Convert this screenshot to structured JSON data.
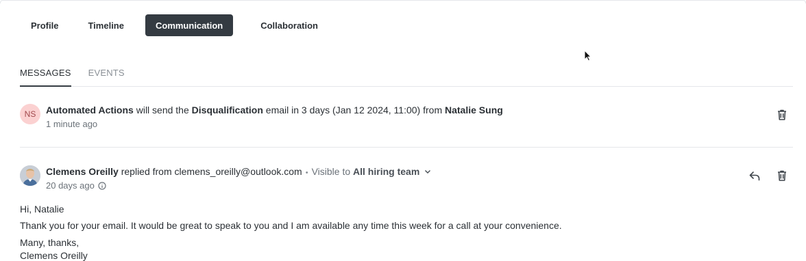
{
  "main_tabs": [
    {
      "label": "Profile"
    },
    {
      "label": "Timeline"
    },
    {
      "label": "Communication"
    },
    {
      "label": "Collaboration"
    }
  ],
  "sub_tabs": [
    {
      "label": "MESSAGES"
    },
    {
      "label": "EVENTS"
    }
  ],
  "entry1": {
    "avatar_initials": "NS",
    "actor": "Automated Actions",
    "text_a": " will send the ",
    "template": "Disqualification",
    "text_b": " email in 3 days (Jan 12 2024, 11:00) from ",
    "sender": "Natalie Sung",
    "time": "1 minute ago"
  },
  "entry2": {
    "author": "Clemens Oreilly",
    "text_a": " replied from ",
    "email": "clemens_oreilly@outlook.com",
    "visible_prefix": "Visible to ",
    "visibility": "All hiring team",
    "time": "20 days ago",
    "body": {
      "greeting": "Hi, Natalie",
      "line": "Thank you for your email. It would be great to speak to you and I am available any time this week for a call at your convenience.",
      "closing": "Many, thanks,",
      "signature": "Clemens Oreilly"
    }
  },
  "colors": {
    "active_tab": "#343b42",
    "avatar_ns_bg": "#fbd1d1"
  },
  "icons": [
    "trash-icon",
    "reply-icon",
    "info-icon",
    "chevron-down-icon",
    "mouse-cursor-icon"
  ]
}
